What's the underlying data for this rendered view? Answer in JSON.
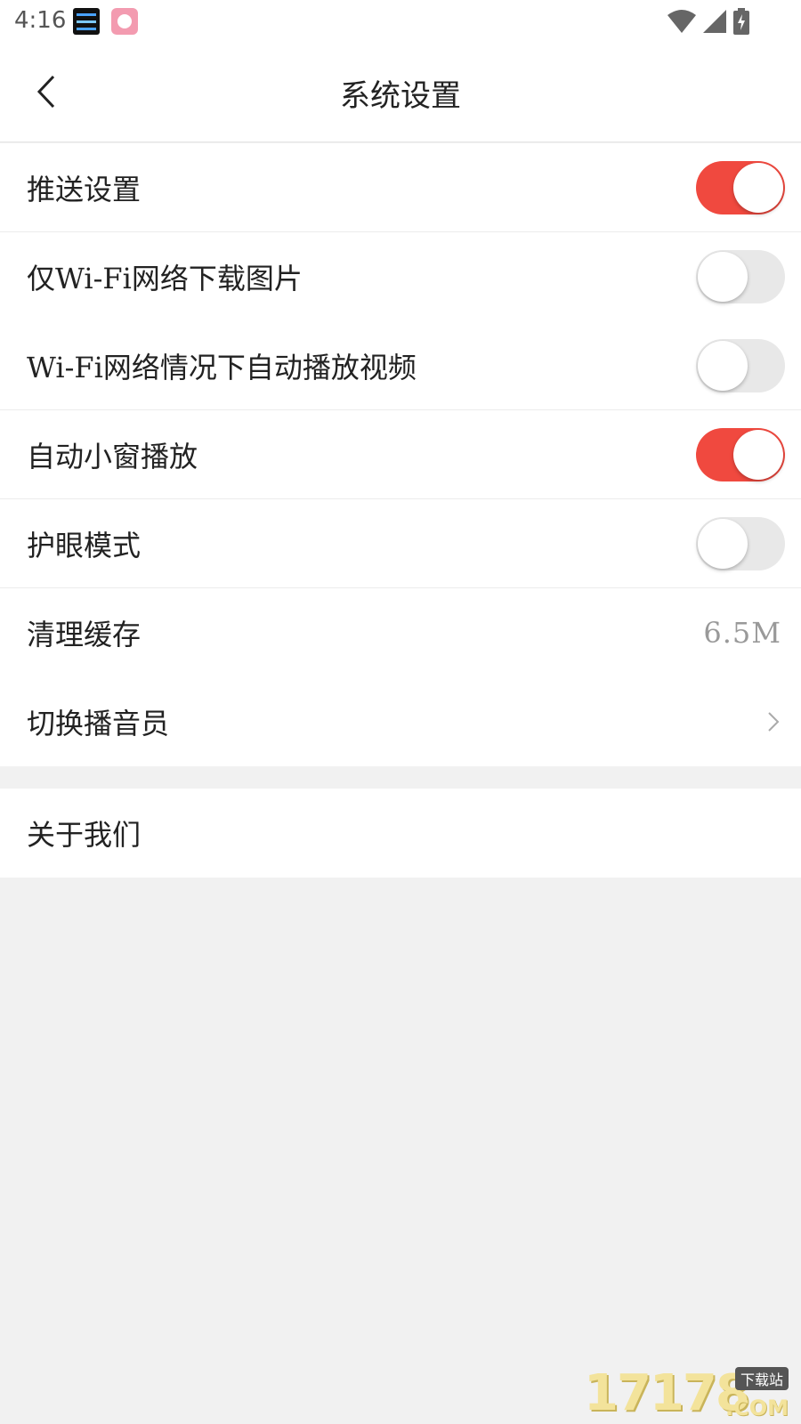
{
  "status_bar": {
    "time": "4:16",
    "icons": [
      "notification-app-icon",
      "notification-rice-icon",
      "wifi-icon",
      "cell-signal-icon",
      "battery-charging-icon"
    ]
  },
  "header": {
    "title": "系统设置",
    "back_icon": "chevron-left-icon"
  },
  "settings": {
    "push": {
      "label": "推送设置",
      "enabled": true
    },
    "wifi_images": {
      "label": "仅Wi-Fi网络下载图片",
      "enabled": false
    },
    "wifi_autoplay": {
      "label": "Wi-Fi网络情况下自动播放视频",
      "enabled": false
    },
    "mini_window": {
      "label": "自动小窗播放",
      "enabled": true
    },
    "eye_care": {
      "label": "护眼模式",
      "enabled": false
    },
    "cache": {
      "label": "清理缓存",
      "value": "6.5M"
    },
    "announcer": {
      "label": "切换播音员"
    },
    "about": {
      "label": "关于我们"
    }
  },
  "watermark": {
    "number": "17178",
    "tag": "下载站",
    "suffix": ".COM"
  },
  "colors": {
    "accent": "#f0493f",
    "toggle_off": "#e8e8e8",
    "background": "#f1f1f1"
  }
}
